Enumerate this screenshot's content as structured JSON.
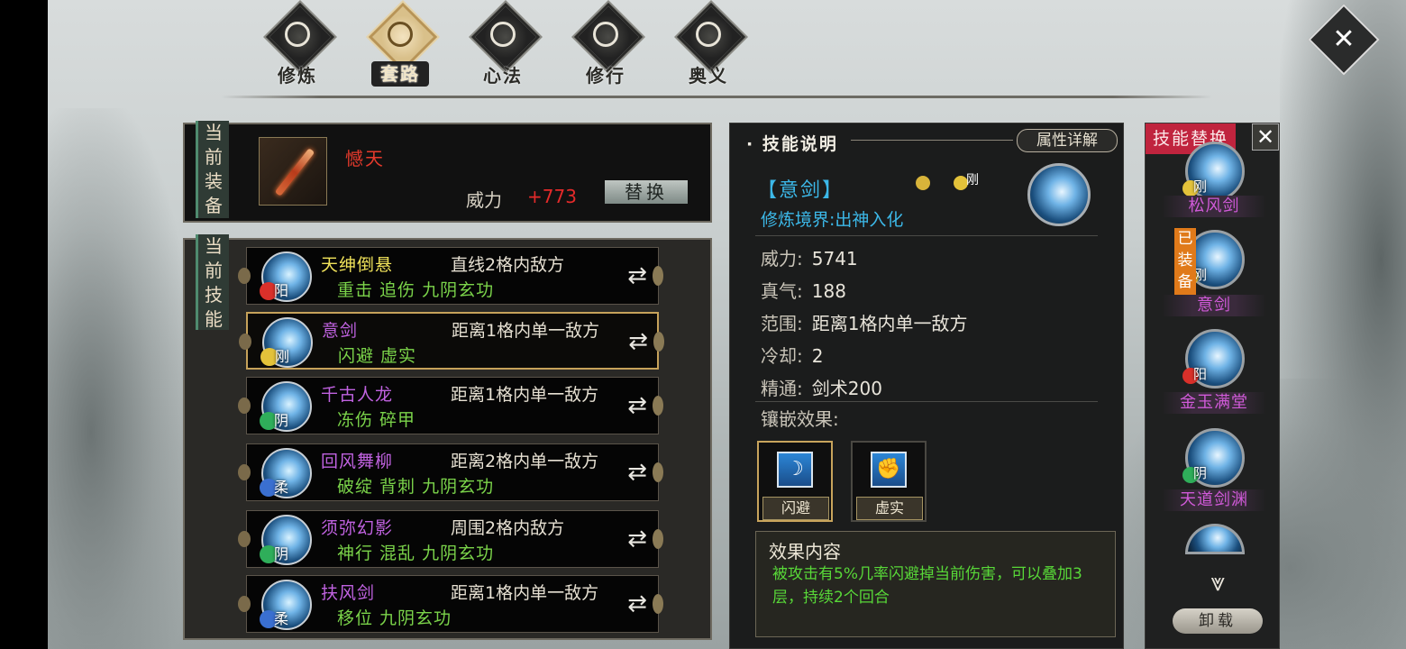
{
  "tabs": [
    {
      "label": "修炼",
      "active": false
    },
    {
      "label": "套路",
      "active": true
    },
    {
      "label": "心法",
      "active": false
    },
    {
      "label": "修行",
      "active": false
    },
    {
      "label": "奥义",
      "active": false
    }
  ],
  "close_icon": "x-mark-icon",
  "current_equip": {
    "tag": "当前装备",
    "name": "憾天",
    "power_label": "威力",
    "power_value": "+773",
    "replace_label": "替换"
  },
  "current_skills": {
    "tag": "当前技能",
    "rows": [
      {
        "name": "天绅倒悬",
        "range": "直线2格内敌方",
        "tags": "重击 追伤 九阴玄功",
        "element": "阳",
        "name_color": "#f0e25a",
        "badge_color": "#d9302a",
        "selected": false
      },
      {
        "name": "意剑",
        "range": "距离1格内单一敌方",
        "tags": "闪避 虚实",
        "element": "刚",
        "name_color": "#c062e0",
        "badge_color": "#e3c23a",
        "selected": true
      },
      {
        "name": "千古人龙",
        "range": "距离1格内单一敌方",
        "tags": "冻伤 碎甲",
        "element": "阴",
        "name_color": "#c062e0",
        "badge_color": "#2fae5a",
        "selected": false
      },
      {
        "name": "回风舞柳",
        "range": "距离2格内单一敌方",
        "tags": "破绽 背刺 九阴玄功",
        "element": "柔",
        "name_color": "#c062e0",
        "badge_color": "#3a6fd0",
        "selected": false
      },
      {
        "name": "须弥幻影",
        "range": "周围2格内敌方",
        "tags": "神行 混乱 九阴玄功",
        "element": "阴",
        "name_color": "#c062e0",
        "badge_color": "#2fae5a",
        "selected": false
      },
      {
        "name": "扶风剑",
        "range": "距离1格内单一敌方",
        "tags": "移位 九阴玄功",
        "element": "柔",
        "name_color": "#c062e0",
        "badge_color": "#3a6fd0",
        "selected": false
      }
    ]
  },
  "detail": {
    "header": "技能说明",
    "attr_button": "属性详解",
    "skill_name": "【意剑】",
    "element_tag": "刚",
    "realm": "修炼境界:出神入化",
    "stats": [
      {
        "label": "威力:",
        "value": "5741"
      },
      {
        "label": "真气:",
        "value": "188"
      },
      {
        "label": "范围:",
        "value": "距离1格内单一敌方"
      },
      {
        "label": "冷却:",
        "value": "2"
      },
      {
        "label": "精通:",
        "value": "剑术200"
      }
    ],
    "inlay_label": "镶嵌效果:",
    "inlays": [
      {
        "label": "闪避",
        "icon": "dodge-icon",
        "selected": true
      },
      {
        "label": "虚实",
        "icon": "fist-icon",
        "selected": false
      }
    ],
    "effect_title": "效果内容",
    "effect_text": "被攻击有5%几率闪避掉当前伤害，可以叠加3层，持续2个回合"
  },
  "replace_panel": {
    "title": "技能替换",
    "close": "✕",
    "items": [
      {
        "name": "松风剑",
        "element": "刚",
        "badge_color": "#e3c23a",
        "equipped": false
      },
      {
        "name": "意剑",
        "element": "刚",
        "badge_color": "#e3c23a",
        "equipped": true,
        "equipped_label": "已装备"
      },
      {
        "name": "金玉满堂",
        "element": "阳",
        "badge_color": "#d9302a",
        "equipped": false
      },
      {
        "name": "天道剑渊",
        "element": "阴",
        "badge_color": "#2fae5a",
        "equipped": false
      }
    ],
    "unload_label": "卸载"
  }
}
